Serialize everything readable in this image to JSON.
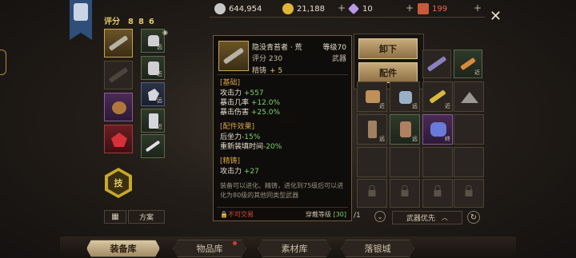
{
  "currencies": [
    {
      "icon": "silver-coin-icon",
      "value": "644,954"
    },
    {
      "icon": "gold-coin-icon",
      "value": "21,188"
    },
    {
      "icon": "diamond-icon",
      "value": "10"
    },
    {
      "icon": "ticket-icon",
      "value": "199"
    }
  ],
  "score": {
    "label": "评分",
    "value": "886"
  },
  "skill_label": "技",
  "plan_label": "方案",
  "tooltip": {
    "name": "隐没青苔者 · 荒",
    "level": "等级70",
    "score": "评分 230",
    "type": "武器",
    "refine_label": "精铸",
    "refine_value": "+ 5",
    "sections": [
      {
        "title": "[基础]",
        "lines": [
          {
            "label": "攻击力",
            "value": "+557"
          },
          {
            "label": "暴击几率",
            "value": "+12.0%"
          },
          {
            "label": "暴击伤害",
            "value": "+25.0%"
          }
        ]
      },
      {
        "title": "[配件效果]",
        "lines": [
          {
            "label": "后坐力",
            "value": "-15%"
          },
          {
            "label": "重新装填时间",
            "value": "-20%"
          }
        ]
      },
      {
        "title": "[精铸]",
        "lines": [
          {
            "label": "攻击力",
            "value": "+27"
          }
        ]
      }
    ],
    "description": "装备可以进化、精铸，进化到75级后可以进化为80级的其他同类型武器",
    "trade": "不可交易",
    "wear_label": "穿戴等级",
    "wear_level": "[30]"
  },
  "actions": {
    "unequip": "卸下",
    "parts": "配件"
  },
  "page_indicator": "/1",
  "sort_label": "武器优先",
  "tabs": [
    {
      "label": "装备库",
      "active": true
    },
    {
      "label": "物品库",
      "active": false
    },
    {
      "label": "素材库",
      "active": false
    },
    {
      "label": "落银城",
      "active": false
    }
  ],
  "inventory_tags": [
    "近",
    "近",
    "远",
    "近",
    "远",
    "远",
    "终"
  ],
  "equip_tags": [
    "远",
    "近",
    "远",
    "近"
  ]
}
